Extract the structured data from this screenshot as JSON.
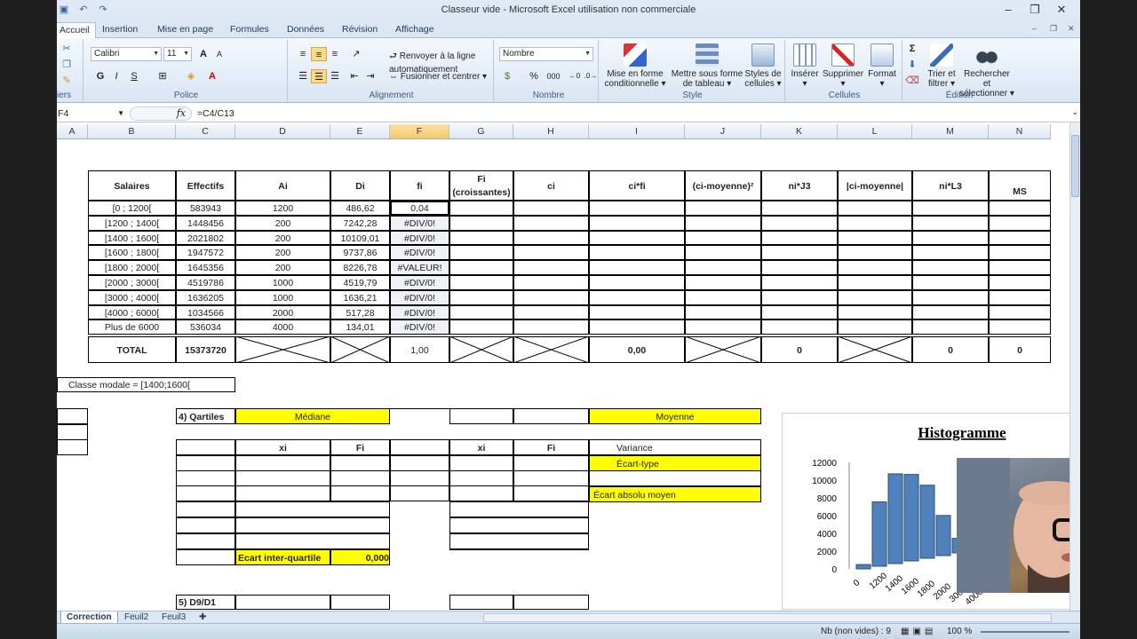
{
  "window": {
    "title": "Classeur vide - Microsoft Excel utilisation non commerciale"
  },
  "qat_icons": [
    "save-icon",
    "undo-icon",
    "redo-icon"
  ],
  "tabs": [
    "Accueil",
    "Insertion",
    "Mise en page",
    "Formules",
    "Données",
    "Révision",
    "Affichage"
  ],
  "ribbon": {
    "clipboard_label": "iers",
    "font_name": "Calibri",
    "font_size": "11",
    "grow": "A",
    "shrink": "A",
    "bold": "G",
    "italic": "I",
    "underline": "S",
    "police_label": "Police",
    "wrap_text": "Renvoyer à la ligne automatiquement",
    "merge_center": "Fusionner et centrer",
    "alignment_label": "Alignement",
    "number_format": "Nombre",
    "percent": "%",
    "thousands": "000",
    "number_label": "Nombre",
    "cond_format_1": "Mise en forme",
    "cond_format_2": "conditionnelle",
    "table_format_1": "Mettre sous forme",
    "table_format_2": "de tableau",
    "cell_styles_1": "Styles de",
    "cell_styles_2": "cellules",
    "style_label": "Style",
    "insert": "Insérer",
    "delete": "Supprimer",
    "format": "Format",
    "cells_label": "Cellules",
    "sort_1": "Trier et",
    "sort_2": "filtrer",
    "find_1": "Rechercher et",
    "find_2": "sélectionner",
    "edit_label": "Édition",
    "sigma": "Σ"
  },
  "formula_bar": {
    "name_box": "F4",
    "fx": "fx",
    "formula": "=C4/C13"
  },
  "columns": [
    "A",
    "B",
    "C",
    "D",
    "E",
    "F",
    "G",
    "H",
    "I",
    "J",
    "K",
    "L",
    "M",
    "N"
  ],
  "table": {
    "headers": [
      "Salaires",
      "Effectifs",
      "Ai",
      "Di",
      "fi",
      "Fi (croissantes)",
      "ci",
      "ci*fi",
      "(ci-moyenne)²",
      "ni*J3",
      "|ci-moyenne|",
      "ni*L3",
      "MS"
    ],
    "rows": [
      [
        "[0 ; 1200[",
        "583943",
        "1200",
        "486,62",
        "0,04"
      ],
      [
        "[1200 ; 1400[",
        "1448456",
        "200",
        "7242,28",
        "#DIV/0!"
      ],
      [
        "[1400 ; 1600[",
        "2021802",
        "200",
        "10109,01",
        "#DIV/0!"
      ],
      [
        "[1600 ; 1800[",
        "1947572",
        "200",
        "9737,86",
        "#DIV/0!"
      ],
      [
        "[1800 ; 2000[",
        "1645356",
        "200",
        "8226,78",
        "#VALEUR!"
      ],
      [
        "[2000 ; 3000[",
        "4519786",
        "1000",
        "4519,79",
        "#DIV/0!"
      ],
      [
        "[3000 ; 4000[",
        "1636205",
        "1000",
        "1636,21",
        "#DIV/0!"
      ],
      [
        "[4000 ; 6000[",
        "1034566",
        "2000",
        "517,28",
        "#DIV/0!"
      ],
      [
        "Plus de 6000",
        "536034",
        "4000",
        "134,01",
        "#DIV/0!"
      ]
    ],
    "total": {
      "label": "TOTAL",
      "effectifs": "15373720",
      "fi": "1,00",
      "cifi": "0,00",
      "nij3": "0",
      "nil3": "0",
      "ms": "0"
    }
  },
  "modal": "Classe modale = [1400;1600[",
  "quartiles": {
    "label": "4) Qartiles",
    "mediane": "Médiane",
    "xi": "xi",
    "fi": "Fi",
    "ecart_iq": "Ecart inter-quartile",
    "ecart_iq_val": "0,000"
  },
  "stats": {
    "moyenne": "Moyenne",
    "variance": "Variance",
    "ecart_type": "Écart-type",
    "ecart_abs": "Écart absolu moyen"
  },
  "d9d1": "5) D9/D1",
  "chart_data": {
    "type": "bar",
    "title": "Histogramme",
    "yticks": [
      "12000",
      "10000",
      "8000",
      "6000",
      "4000",
      "2000",
      "0"
    ],
    "ylim": [
      0,
      12000
    ],
    "categories": [
      "0",
      "1200",
      "1400",
      "1600",
      "1800",
      "2000",
      "3000",
      "4000"
    ],
    "values": [
      486.62,
      7242.28,
      10109.01,
      9737.86,
      8226.78,
      4519.79,
      1636.21,
      517.28
    ]
  },
  "sheets": [
    "Correction",
    "Feuil2",
    "Feuil3"
  ],
  "status": {
    "count": "Nb (non vides) : 9",
    "zoom": "100 %"
  }
}
